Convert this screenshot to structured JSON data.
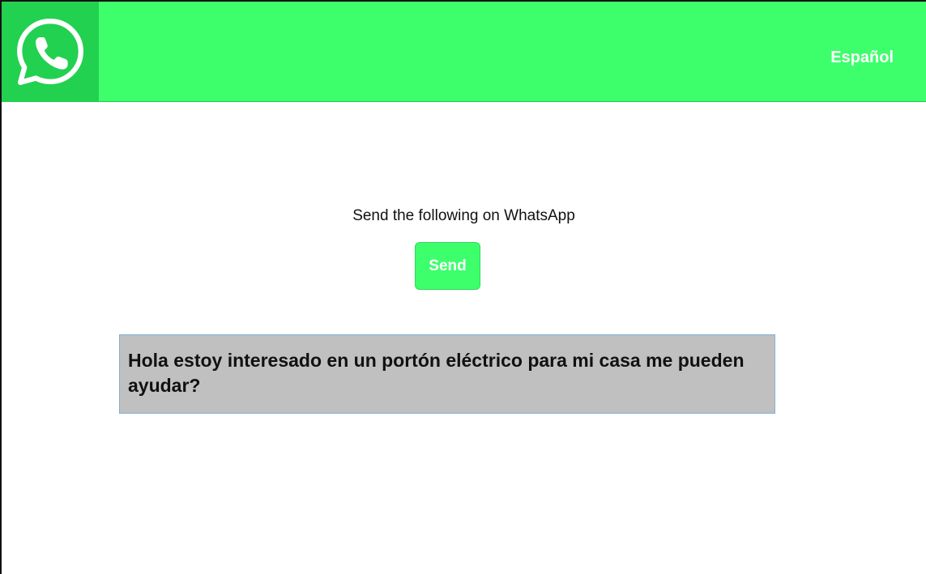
{
  "header": {
    "logo_icon": "whatsapp-logo-icon",
    "language_label": "Español",
    "background_color": "#3dff6c",
    "logo_background_color": "#22d14f"
  },
  "main": {
    "prompt_text": "Send the following on WhatsApp",
    "send_button_label": "Send",
    "message_text": "Hola estoy interesado en un portón eléctrico para mi casa me pueden ayudar?",
    "message_background_color": "#c0c0c0"
  }
}
